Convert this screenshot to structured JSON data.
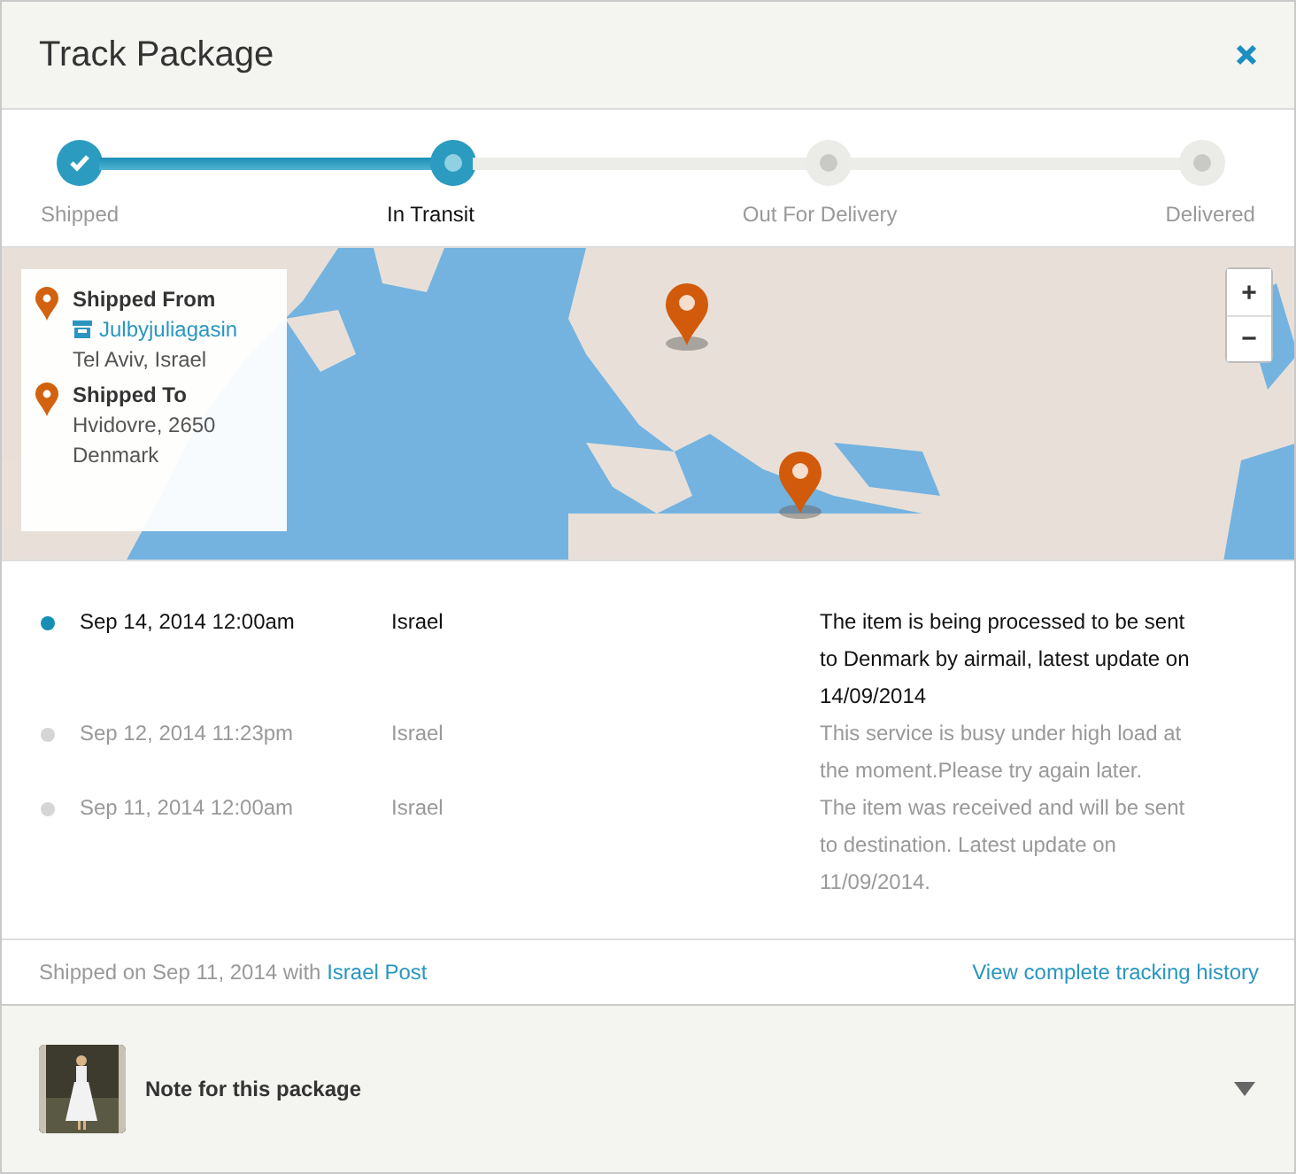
{
  "window": {
    "title": "Track Package"
  },
  "steps": [
    {
      "label": "Shipped",
      "completed": true,
      "selected": false
    },
    {
      "label": "In Transit",
      "completed": false,
      "selected": true
    },
    {
      "label": "Out For Delivery",
      "completed": false,
      "selected": false
    },
    {
      "label": "Delivered",
      "completed": false,
      "selected": false
    }
  ],
  "map": {
    "zoom_in": "+",
    "zoom_out": "−",
    "origin": {
      "heading": "Shipped From",
      "store": "Julbyjuliagasin",
      "place": "Tel Aviv, Israel"
    },
    "destination": {
      "heading": "Shipped To",
      "lines": [
        "Hvidovre, 2650",
        "Denmark"
      ]
    }
  },
  "events": [
    {
      "date": "Sep 14, 2014 12:00am",
      "location": "Israel",
      "description": "The item is being processed to be sent to Denmark by airmail, latest update on 14/09/2014",
      "current": true
    },
    {
      "date": "Sep 12, 2014 11:23pm",
      "location": "Israel",
      "description": "This service is busy under high load at the moment.Please try again later.",
      "current": false
    },
    {
      "date": "Sep 11, 2014 12:00am",
      "location": "Israel",
      "description": "The item was received and will be sent to destination. Latest update on 11/09/2014.",
      "current": false
    }
  ],
  "footer": {
    "shipped_text": "Shipped on Sep 11, 2014 with ",
    "carrier": "Israel Post",
    "history_link": "View complete tracking history"
  },
  "note": {
    "label": "Note for this package",
    "expanded": false
  }
}
